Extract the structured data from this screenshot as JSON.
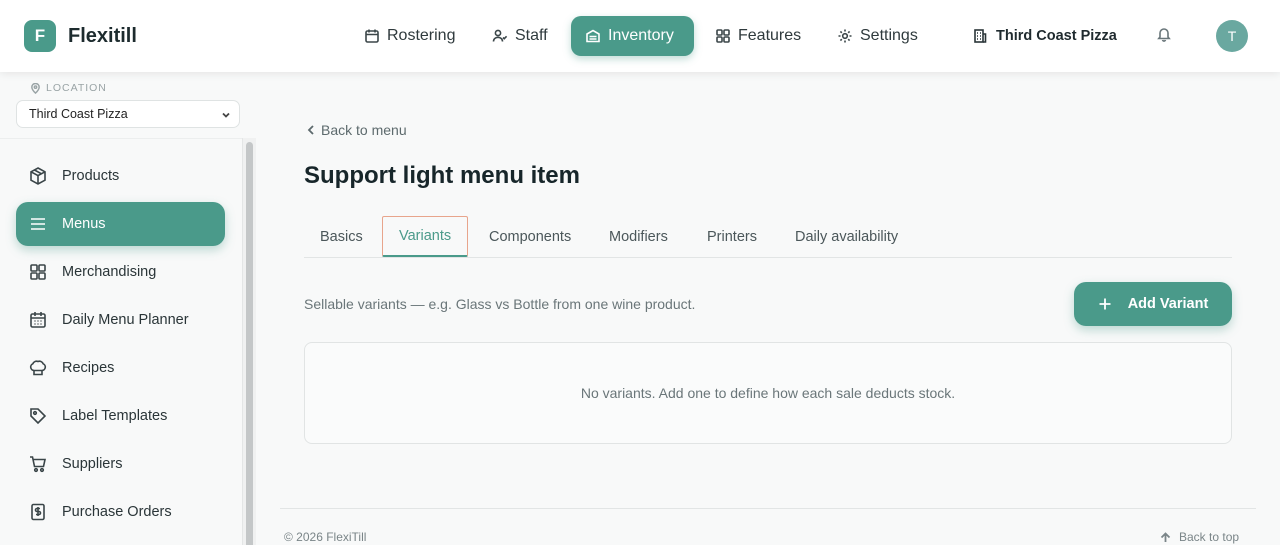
{
  "app": {
    "logo_letter": "F",
    "name": "Flexitill"
  },
  "nav": [
    {
      "label": "Rostering",
      "icon": "calendar-icon"
    },
    {
      "label": "Staff",
      "icon": "users-icon"
    },
    {
      "label": "Inventory",
      "icon": "inventory-icon",
      "active": true
    },
    {
      "label": "Features",
      "icon": "grid-icon"
    },
    {
      "label": "Settings",
      "icon": "gear-icon"
    }
  ],
  "header": {
    "store": "Third Coast Pizza",
    "avatar_initial": "T"
  },
  "sidebar": {
    "location_label": "LOCATION",
    "location_value": "Third Coast Pizza",
    "items": [
      {
        "label": "Products",
        "icon": "box-icon"
      },
      {
        "label": "Menus",
        "icon": "menu-icon",
        "active": true
      },
      {
        "label": "Merchandising",
        "icon": "grid-icon"
      },
      {
        "label": "Daily Menu Planner",
        "icon": "calendar-icon"
      },
      {
        "label": "Recipes",
        "icon": "chef-hat-icon"
      },
      {
        "label": "Label Templates",
        "icon": "tag-icon"
      },
      {
        "label": "Suppliers",
        "icon": "cart-icon"
      },
      {
        "label": "Purchase Orders",
        "icon": "dollar-doc-icon"
      }
    ]
  },
  "main": {
    "back_label": "Back to menu",
    "title": "Support light menu item",
    "tabs": [
      {
        "label": "Basics"
      },
      {
        "label": "Variants",
        "active": true
      },
      {
        "label": "Components"
      },
      {
        "label": "Modifiers"
      },
      {
        "label": "Printers"
      },
      {
        "label": "Daily availability"
      }
    ],
    "description": "Sellable variants — e.g. Glass vs Bottle from one wine product.",
    "add_button_label": "Add Variant",
    "empty_message": "No variants. Add one to define how each sale deducts stock."
  },
  "footer": {
    "copyright": "© 2026 FlexiTill",
    "back_to_top": "Back to top"
  },
  "colors": {
    "accent": "#4a9a8a",
    "active_tab_outline": "#e8a58c"
  }
}
